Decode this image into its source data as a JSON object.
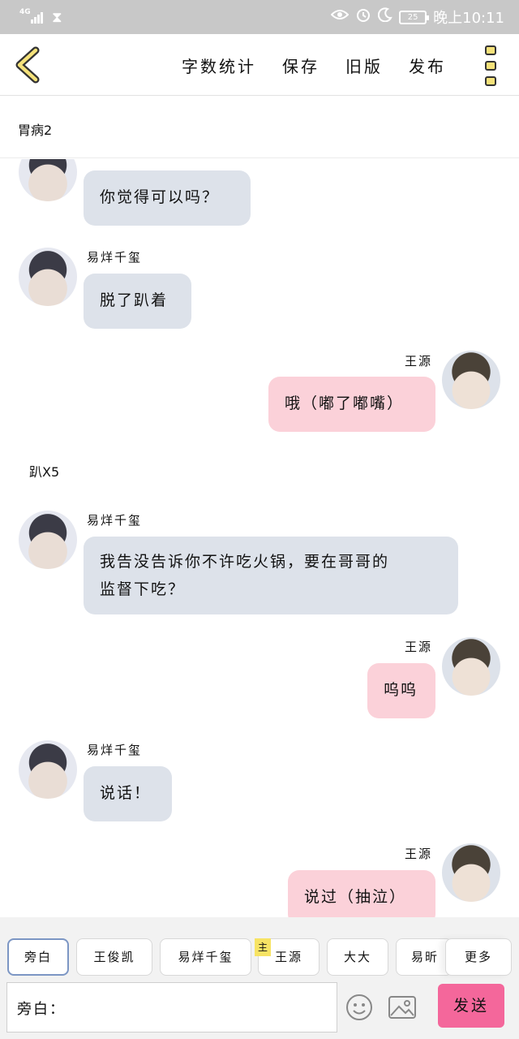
{
  "status_bar": {
    "network": "4G",
    "signal_icon": "signal-bars-icon",
    "hourglass_icon": "hourglass-icon",
    "eye_icon": "eye-icon",
    "alarm_icon": "alarm-icon",
    "moon_icon": "moon-icon",
    "battery": "25",
    "time": "晚上10:11"
  },
  "toolbar": {
    "back_icon": "chevron-left-icon",
    "word_count": "字数统计",
    "save": "保存",
    "old_version": "旧版",
    "publish": "发布",
    "menu_icon": "three-squares-menu-icon"
  },
  "chapter": {
    "title": "胃病2"
  },
  "messages": [
    {
      "side": "left",
      "sender": "",
      "text": "你觉得可以吗？"
    },
    {
      "side": "left",
      "sender": "易烊千玺",
      "text": "脱了趴着"
    },
    {
      "side": "right",
      "sender": "王源",
      "text": "哦（嘟了嘟嘴）"
    },
    {
      "side": "narration",
      "text": "趴X5"
    },
    {
      "side": "left",
      "sender": "易烊千玺",
      "text_line1": "我告没告诉你不许吃火锅，要在哥哥的",
      "text_line2": "监督下吃？"
    },
    {
      "side": "right",
      "sender": "王源",
      "text": "呜呜"
    },
    {
      "side": "left",
      "sender": "易烊千玺",
      "text": "说话！"
    },
    {
      "side": "right",
      "sender": "王源",
      "text": "说过（抽泣）"
    }
  ],
  "roles": {
    "items": [
      "旁白",
      "王俊凯",
      "易烊千玺",
      "王源",
      "大大",
      "易昕"
    ],
    "main_badge": "主",
    "more": "更多"
  },
  "composer": {
    "prefix": "旁白：",
    "emoji_icon": "smiley-icon",
    "image_icon": "image-icon",
    "send": "发送"
  },
  "colors": {
    "bubble_left": "#dde2ea",
    "bubble_right": "#fbd1d9",
    "send_button": "#f4679b",
    "accent_yellow": "#f5e27a"
  }
}
